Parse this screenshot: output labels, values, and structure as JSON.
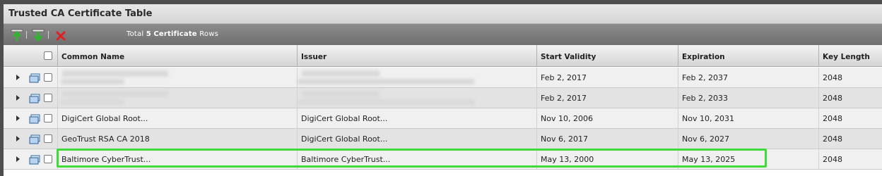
{
  "window": {
    "title": "Trusted CA Certificate Table"
  },
  "toolbar": {
    "total_prefix": "Total",
    "total_count": "5",
    "total_mid": "Certificate",
    "total_suffix": "Rows",
    "buttons": [
      {
        "name": "import-icon",
        "color": "#2fb52f"
      },
      {
        "name": "export-icon",
        "color": "#2fb52f"
      },
      {
        "name": "delete-icon",
        "color": "#e02020"
      }
    ]
  },
  "table": {
    "columns": [
      "Common Name",
      "Issuer",
      "Start Validity",
      "Expiration",
      "Key Length"
    ],
    "rows": [
      {
        "common_name": "",
        "issuer": "",
        "start": "Feb 2, 2017",
        "expiration": "Feb 2, 2037",
        "key_length": "2048",
        "redacted": true
      },
      {
        "common_name": "",
        "issuer": "",
        "start": "Feb 2, 2017",
        "expiration": "Feb 2, 2033",
        "key_length": "2048",
        "redacted": true
      },
      {
        "common_name": "DigiCert Global Root...",
        "issuer": "DigiCert Global Root...",
        "start": "Nov 10, 2006",
        "expiration": "Nov 10, 2031",
        "key_length": "2048",
        "redacted": false
      },
      {
        "common_name": "GeoTrust RSA CA 2018",
        "issuer": "DigiCert Global Root...",
        "start": "Nov 6, 2017",
        "expiration": "Nov 6, 2027",
        "key_length": "2048",
        "redacted": false
      },
      {
        "common_name": "Baltimore CyberTrust...",
        "issuer": "Baltimore CyberTrust...",
        "start": "May 13, 2000",
        "expiration": "May 13, 2025",
        "key_length": "2048",
        "redacted": false,
        "highlighted": true
      }
    ]
  },
  "colors": {
    "highlight": "#3fd93a",
    "toolbar": "#7d7d7d"
  }
}
